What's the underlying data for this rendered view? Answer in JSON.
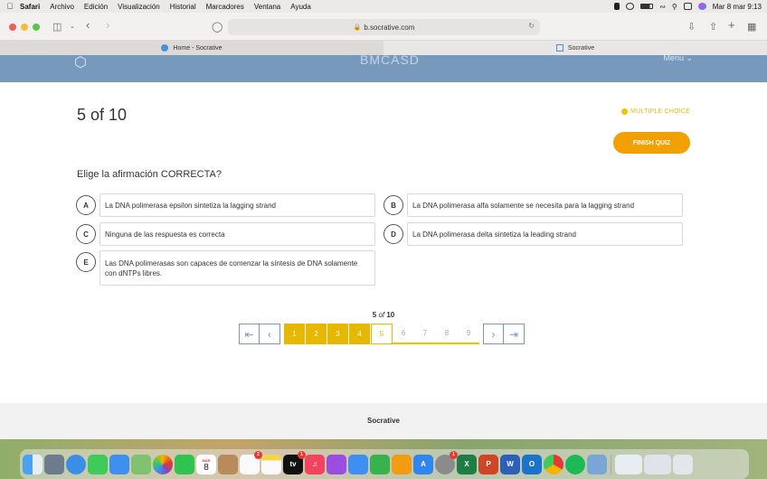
{
  "menubar": {
    "apple": "",
    "items": [
      "Safari",
      "Archivo",
      "Edición",
      "Visualización",
      "Historial",
      "Marcadores",
      "Ventana",
      "Ayuda"
    ],
    "datetime": "Mar 8 mar  9:13"
  },
  "browser": {
    "url": "b.socrative.com",
    "tabs": [
      {
        "title": "Home - Socrative"
      },
      {
        "title": "Socrative"
      }
    ]
  },
  "site_header": {
    "brand": "BMCASD",
    "menu_label": "Menu ⌄"
  },
  "quiz": {
    "counter": "5 of 10",
    "question_type": "MULTIPLE CHOICE",
    "finish_label": "FINISH QUIZ",
    "question": "Elige la afirmación CORRECTA?",
    "answers": [
      {
        "letter": "A",
        "text": "La DNA polimerasa epsilon sintetiza la lagging strand"
      },
      {
        "letter": "B",
        "text": "La DNA polimerasa alfa solamente se necesita para la lagging strand"
      },
      {
        "letter": "C",
        "text": "Ninguna de las respuesta es correcta"
      },
      {
        "letter": "D",
        "text": "La DNA polimerasa delta sintetiza la leading strand"
      },
      {
        "letter": "E",
        "text": "Las DNA polimerasas son capaces de comenzar la síntesis de DNA solamente con dNTPs libres."
      }
    ]
  },
  "pagination": {
    "current": "5",
    "of_word": "of",
    "total": "10",
    "pages": [
      "1",
      "2",
      "3",
      "4",
      "5",
      "6",
      "7",
      "8",
      "9"
    ],
    "first_icon": "first-page-icon",
    "prev_icon": "previous-page-icon",
    "next_icon": "next-page-icon",
    "last_icon": "last-page-icon"
  },
  "footer": {
    "label": "Socrative"
  },
  "dock": {
    "calendar_month": "MAR",
    "calendar_day": "8",
    "tv_label": "tv",
    "badges": {
      "reminders": "2",
      "tv": "1",
      "settings": "1"
    }
  },
  "colors": {
    "header": "#7699bd",
    "accent_yellow": "#e6b800",
    "finish_orange": "#f2a000"
  }
}
